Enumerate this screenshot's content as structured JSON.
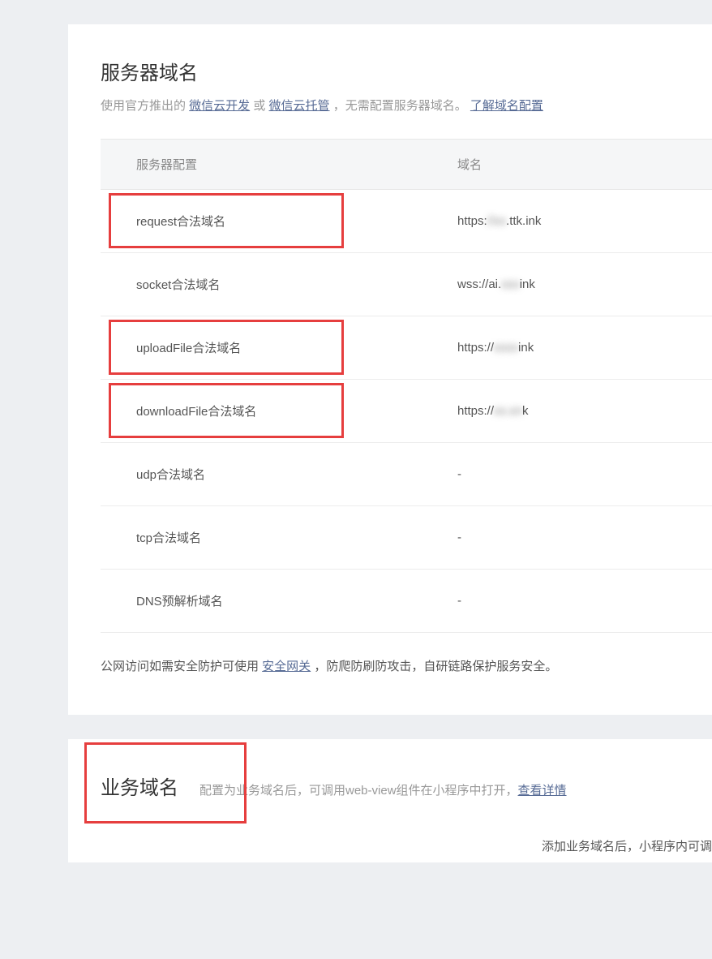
{
  "section1": {
    "title": "服务器域名",
    "subtitle_pre": "使用官方推出的 ",
    "link1": "微信云开发",
    "subtitle_mid1": " 或 ",
    "link2": "微信云托管",
    "subtitle_mid2": " ，无需配置服务器域名。 ",
    "link3": "了解域名配置",
    "header_col1": "服务器配置",
    "header_col2": "域名",
    "rows": [
      {
        "label": "request合法域名",
        "value_pre": "https:",
        "value_blur": "//xx",
        "value_post": ".ttk.ink",
        "hl": true
      },
      {
        "label": "socket合法域名",
        "value_pre": "wss://ai.",
        "value_blur": "xxx",
        "value_post": "ink",
        "hl": false
      },
      {
        "label": "uploadFile合法域名",
        "value_pre": "https://",
        "value_blur": "xxxx",
        "value_post": "ink",
        "hl": true
      },
      {
        "label": "downloadFile合法域名",
        "value_pre": "https://",
        "value_blur": "xx.xn",
        "value_post": "k",
        "hl": true
      },
      {
        "label": "udp合法域名",
        "value_pre": "-",
        "value_blur": "",
        "value_post": "",
        "hl": false
      },
      {
        "label": "tcp合法域名",
        "value_pre": "-",
        "value_blur": "",
        "value_post": "",
        "hl": false
      },
      {
        "label": "DNS预解析域名",
        "value_pre": "-",
        "value_blur": "",
        "value_post": "",
        "hl": false
      }
    ],
    "footnote_pre": "公网访问如需安全防护可使用 ",
    "footnote_link": "安全网关",
    "footnote_post": " ，防爬防刷防攻击，自研链路保护服务安全。"
  },
  "section2": {
    "title": "业务域名",
    "sub_pre": "配置为业务域名后，可调用web-view组件在小程序中打开，",
    "sub_link": "查看详情",
    "note": "添加业务域名后，小程序内可调",
    "hl": true
  }
}
